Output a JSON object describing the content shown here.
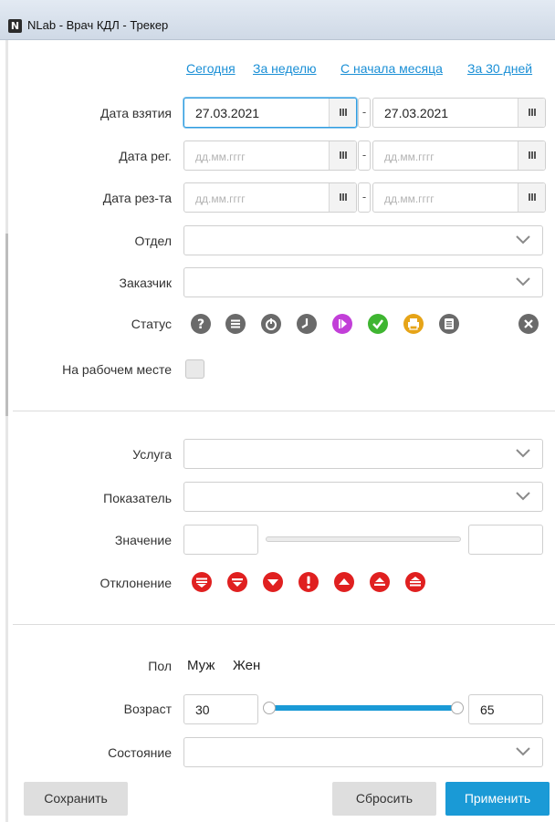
{
  "window": {
    "title": "NLab - Врач КДЛ - Трекер",
    "logo": "N"
  },
  "quick_links": [
    "Сегодня",
    "За неделю",
    "С начала месяца",
    "За 30 дней"
  ],
  "labels": {
    "date_taken": "Дата взятия",
    "date_reg": "Дата рег.",
    "date_result": "Дата рез-та",
    "department": "Отдел",
    "customer": "Заказчик",
    "status": "Статус",
    "at_workplace": "На рабочем месте",
    "service": "Услуга",
    "indicator": "Показатель",
    "value": "Значение",
    "deviation": "Отклонение",
    "sex": "Пол",
    "age": "Возраст",
    "state": "Состояние"
  },
  "dates": {
    "taken_from": "27.03.2021",
    "taken_to": "27.03.2021",
    "placeholder": "дд.мм.гггг",
    "separator": "-"
  },
  "status_icons": [
    {
      "name": "question-icon",
      "color": "#666666"
    },
    {
      "name": "list-icon",
      "color": "#666666"
    },
    {
      "name": "power-icon",
      "color": "#666666"
    },
    {
      "name": "clock-icon",
      "color": "#666666"
    },
    {
      "name": "play-icon",
      "color": "#c23fd8"
    },
    {
      "name": "check-icon",
      "color": "#3fb531"
    },
    {
      "name": "print-icon",
      "color": "#e6a418"
    },
    {
      "name": "document-icon",
      "color": "#666666"
    },
    {
      "name": "close-icon",
      "color": "#666666"
    }
  ],
  "deviation_icons": [
    {
      "name": "deviation-critical-low-icon",
      "color": "#e02020"
    },
    {
      "name": "deviation-very-low-icon",
      "color": "#e02020"
    },
    {
      "name": "deviation-low-icon",
      "color": "#e02020"
    },
    {
      "name": "deviation-alert-icon",
      "color": "#e02020"
    },
    {
      "name": "deviation-high-icon",
      "color": "#e02020"
    },
    {
      "name": "deviation-very-high-icon",
      "color": "#e02020"
    },
    {
      "name": "deviation-critical-high-icon",
      "color": "#e02020"
    }
  ],
  "sex_options": [
    "Муж",
    "Жен"
  ],
  "age": {
    "min": "30",
    "max": "65"
  },
  "buttons": {
    "save": "Сохранить",
    "reset": "Сбросить",
    "apply": "Применить"
  },
  "colors": {
    "accent": "#1a9ad6",
    "link": "#1a8fd6"
  }
}
